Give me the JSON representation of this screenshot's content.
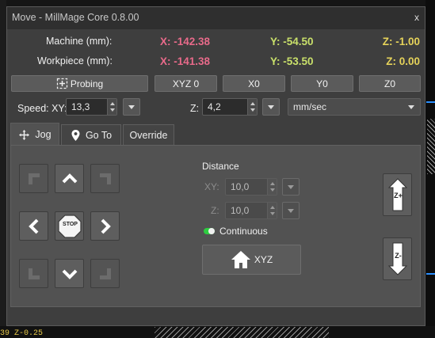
{
  "window": {
    "title": "Move - MillMage Core 0.8.00",
    "close_glyph": "x"
  },
  "position": {
    "machine_label": "Machine (mm):",
    "machine": {
      "x": "X: -142.38",
      "y": "Y: -54.50",
      "z": "Z: -1.00"
    },
    "workpiece_label": "Workpiece (mm):",
    "workpiece": {
      "x": "X: -141.38",
      "y": "Y: -53.50",
      "z": "Z: 0.00"
    }
  },
  "toolbar": {
    "probing": "Probing",
    "xyz0": "XYZ 0",
    "x0": "X0",
    "y0": "Y0",
    "z0": "Z0"
  },
  "speed": {
    "xy_label": "Speed: XY:",
    "xy_value": "13,3",
    "z_label": "Z:",
    "z_value": "4,2",
    "unit": "mm/sec"
  },
  "tabs": [
    {
      "label": "Jog",
      "icon": "move-icon",
      "active": true
    },
    {
      "label": "Go To",
      "icon": "location-pin-icon",
      "active": false
    },
    {
      "label": "Override",
      "icon": "",
      "active": false
    }
  ],
  "jog": {
    "stop_label": "STOP",
    "distance_label": "Distance",
    "xy_label": "XY:",
    "xy_value": "10,0",
    "z_label": "Z:",
    "z_value": "10,0",
    "continuous_label": "Continuous",
    "continuous_on": true,
    "home_label": "XYZ",
    "z_up_label": "Z+",
    "z_down_label": "Z-"
  },
  "background_text": "39 Z-0.25",
  "colors": {
    "x_coord": "#e86a8a",
    "y_coord": "#c9e06a",
    "z_coord": "#e6d35a",
    "toggle_on": "#2ecc40"
  }
}
